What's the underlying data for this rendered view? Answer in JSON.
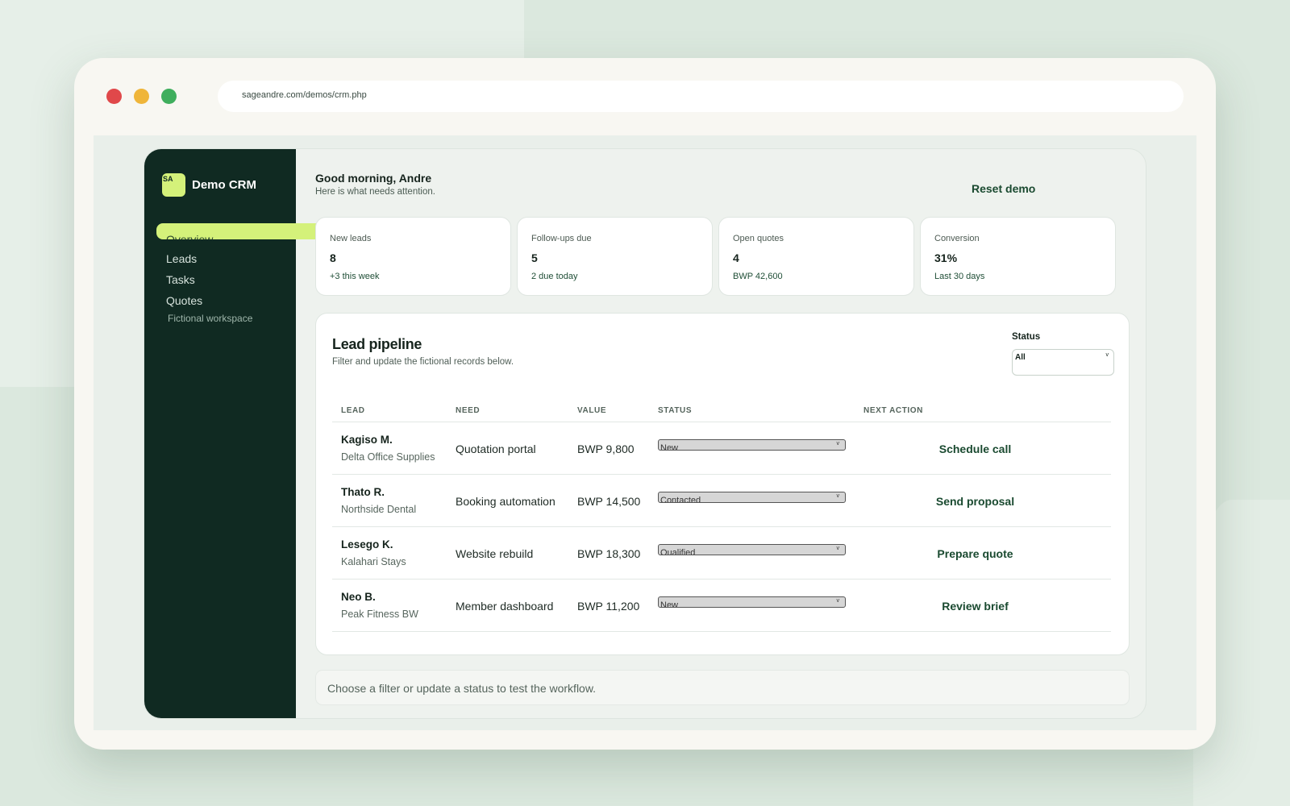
{
  "browser": {
    "url": "sageandre.com/demos/crm.php"
  },
  "sidebar": {
    "badge": "SA",
    "brand": "Demo CRM",
    "items": [
      {
        "label": "Overview",
        "active": true
      },
      {
        "label": "Leads"
      },
      {
        "label": "Tasks"
      },
      {
        "label": "Quotes"
      }
    ],
    "workspace": "Fictional workspace"
  },
  "header": {
    "greeting": "Good morning, Andre",
    "subtitle": "Here is what needs attention.",
    "reset_label": "Reset demo"
  },
  "stats": [
    {
      "label": "New leads",
      "value": "8",
      "note": "+3 this week"
    },
    {
      "label": "Follow-ups due",
      "value": "5",
      "note": "2 due today"
    },
    {
      "label": "Open quotes",
      "value": "4",
      "note": "BWP 42,600"
    },
    {
      "label": "Conversion",
      "value": "31%",
      "note": "Last 30 days"
    }
  ],
  "pipeline": {
    "title": "Lead pipeline",
    "subtitle": "Filter and update the fictional records below.",
    "filter_label": "Status",
    "filter_value": "All",
    "columns": [
      "LEAD",
      "NEED",
      "VALUE",
      "STATUS",
      "NEXT ACTION"
    ],
    "rows": [
      {
        "name": "Kagiso M.",
        "company": "Delta Office Supplies",
        "need": "Quotation portal",
        "value": "BWP 9,800",
        "status": "New",
        "action": "Schedule call"
      },
      {
        "name": "Thato R.",
        "company": "Northside Dental",
        "need": "Booking automation",
        "value": "BWP 14,500",
        "status": "Contacted",
        "action": "Send proposal"
      },
      {
        "name": "Lesego K.",
        "company": "Kalahari Stays",
        "need": "Website rebuild",
        "value": "BWP 18,300",
        "status": "Qualified",
        "action": "Prepare quote"
      },
      {
        "name": "Neo B.",
        "company": "Peak Fitness BW",
        "need": "Member dashboard",
        "value": "BWP 11,200",
        "status": "New",
        "action": "Review brief"
      }
    ]
  },
  "hint": "Choose a filter or update a status to test the workflow."
}
